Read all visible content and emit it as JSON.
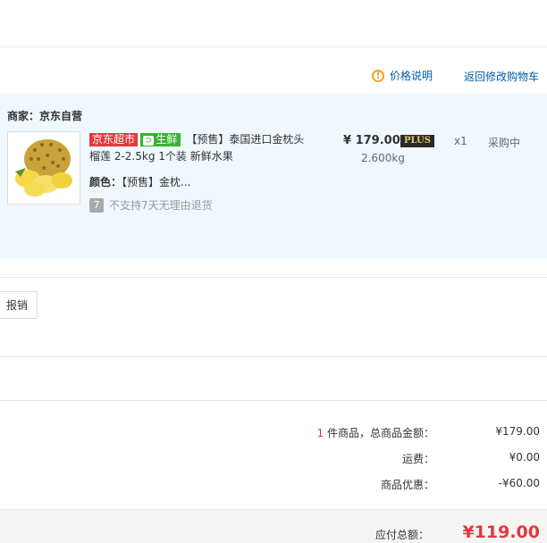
{
  "header": {
    "price_note_label": "价格说明",
    "back_to_cart_label": "返回修改购物车"
  },
  "shop": {
    "seller_label": "商家：京东自营",
    "item": {
      "tag_jd": "京东超市",
      "tag_fresh": "生鲜",
      "name": "【预售】泰国进口金枕头榴莲 2-2.5kg 1个装 新鲜水果",
      "color_label": "颜色：",
      "color_value": "【预售】金枕...",
      "return_icon_text": "7",
      "return_note": "不支持7天无理由退货",
      "price": "¥ 179.00",
      "plus_badge": "PLUS",
      "weight": "2.600kg",
      "qty": "x1",
      "status": "采购中"
    }
  },
  "invoice": {
    "button_label": "报销"
  },
  "summary": {
    "count": "1",
    "count_suffix": " 件商品，总商品金额：",
    "goods_total": "¥179.00",
    "shipping_label": "运费：",
    "shipping": "¥0.00",
    "discount_label": "商品优惠：",
    "discount": "-¥60.00",
    "payable_label": "应付总额：",
    "payable": "¥119.00"
  },
  "colors": {
    "accent_red": "#e4393c",
    "link_blue": "#005ea7",
    "fresh_green": "#3bb033",
    "shop_bg": "#f0f8ff"
  },
  "icons": {
    "price_note": "warning-circle-icon",
    "return": "return-policy-icon"
  }
}
